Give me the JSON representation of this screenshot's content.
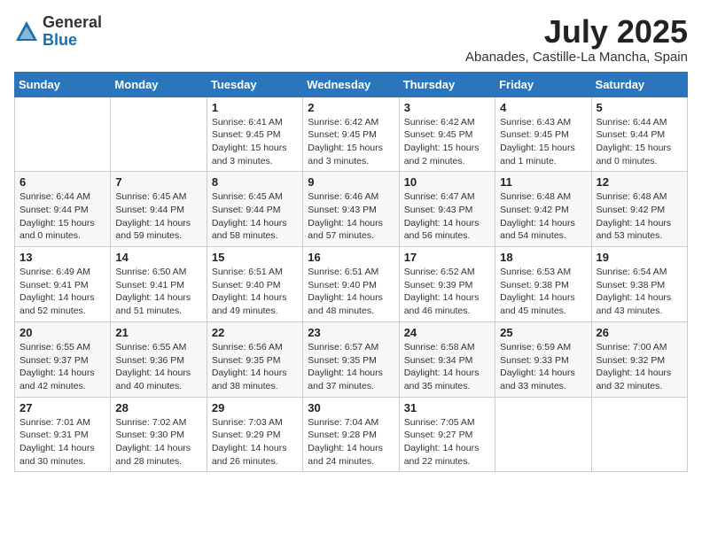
{
  "header": {
    "logo_general": "General",
    "logo_blue": "Blue",
    "month_year": "July 2025",
    "location": "Abanades, Castille-La Mancha, Spain"
  },
  "weekdays": [
    "Sunday",
    "Monday",
    "Tuesday",
    "Wednesday",
    "Thursday",
    "Friday",
    "Saturday"
  ],
  "weeks": [
    [
      {
        "day": "",
        "info": ""
      },
      {
        "day": "",
        "info": ""
      },
      {
        "day": "1",
        "info": "Sunrise: 6:41 AM\nSunset: 9:45 PM\nDaylight: 15 hours\nand 3 minutes."
      },
      {
        "day": "2",
        "info": "Sunrise: 6:42 AM\nSunset: 9:45 PM\nDaylight: 15 hours\nand 3 minutes."
      },
      {
        "day": "3",
        "info": "Sunrise: 6:42 AM\nSunset: 9:45 PM\nDaylight: 15 hours\nand 2 minutes."
      },
      {
        "day": "4",
        "info": "Sunrise: 6:43 AM\nSunset: 9:45 PM\nDaylight: 15 hours\nand 1 minute."
      },
      {
        "day": "5",
        "info": "Sunrise: 6:44 AM\nSunset: 9:44 PM\nDaylight: 15 hours\nand 0 minutes."
      }
    ],
    [
      {
        "day": "6",
        "info": "Sunrise: 6:44 AM\nSunset: 9:44 PM\nDaylight: 15 hours\nand 0 minutes."
      },
      {
        "day": "7",
        "info": "Sunrise: 6:45 AM\nSunset: 9:44 PM\nDaylight: 14 hours\nand 59 minutes."
      },
      {
        "day": "8",
        "info": "Sunrise: 6:45 AM\nSunset: 9:44 PM\nDaylight: 14 hours\nand 58 minutes."
      },
      {
        "day": "9",
        "info": "Sunrise: 6:46 AM\nSunset: 9:43 PM\nDaylight: 14 hours\nand 57 minutes."
      },
      {
        "day": "10",
        "info": "Sunrise: 6:47 AM\nSunset: 9:43 PM\nDaylight: 14 hours\nand 56 minutes."
      },
      {
        "day": "11",
        "info": "Sunrise: 6:48 AM\nSunset: 9:42 PM\nDaylight: 14 hours\nand 54 minutes."
      },
      {
        "day": "12",
        "info": "Sunrise: 6:48 AM\nSunset: 9:42 PM\nDaylight: 14 hours\nand 53 minutes."
      }
    ],
    [
      {
        "day": "13",
        "info": "Sunrise: 6:49 AM\nSunset: 9:41 PM\nDaylight: 14 hours\nand 52 minutes."
      },
      {
        "day": "14",
        "info": "Sunrise: 6:50 AM\nSunset: 9:41 PM\nDaylight: 14 hours\nand 51 minutes."
      },
      {
        "day": "15",
        "info": "Sunrise: 6:51 AM\nSunset: 9:40 PM\nDaylight: 14 hours\nand 49 minutes."
      },
      {
        "day": "16",
        "info": "Sunrise: 6:51 AM\nSunset: 9:40 PM\nDaylight: 14 hours\nand 48 minutes."
      },
      {
        "day": "17",
        "info": "Sunrise: 6:52 AM\nSunset: 9:39 PM\nDaylight: 14 hours\nand 46 minutes."
      },
      {
        "day": "18",
        "info": "Sunrise: 6:53 AM\nSunset: 9:38 PM\nDaylight: 14 hours\nand 45 minutes."
      },
      {
        "day": "19",
        "info": "Sunrise: 6:54 AM\nSunset: 9:38 PM\nDaylight: 14 hours\nand 43 minutes."
      }
    ],
    [
      {
        "day": "20",
        "info": "Sunrise: 6:55 AM\nSunset: 9:37 PM\nDaylight: 14 hours\nand 42 minutes."
      },
      {
        "day": "21",
        "info": "Sunrise: 6:55 AM\nSunset: 9:36 PM\nDaylight: 14 hours\nand 40 minutes."
      },
      {
        "day": "22",
        "info": "Sunrise: 6:56 AM\nSunset: 9:35 PM\nDaylight: 14 hours\nand 38 minutes."
      },
      {
        "day": "23",
        "info": "Sunrise: 6:57 AM\nSunset: 9:35 PM\nDaylight: 14 hours\nand 37 minutes."
      },
      {
        "day": "24",
        "info": "Sunrise: 6:58 AM\nSunset: 9:34 PM\nDaylight: 14 hours\nand 35 minutes."
      },
      {
        "day": "25",
        "info": "Sunrise: 6:59 AM\nSunset: 9:33 PM\nDaylight: 14 hours\nand 33 minutes."
      },
      {
        "day": "26",
        "info": "Sunrise: 7:00 AM\nSunset: 9:32 PM\nDaylight: 14 hours\nand 32 minutes."
      }
    ],
    [
      {
        "day": "27",
        "info": "Sunrise: 7:01 AM\nSunset: 9:31 PM\nDaylight: 14 hours\nand 30 minutes."
      },
      {
        "day": "28",
        "info": "Sunrise: 7:02 AM\nSunset: 9:30 PM\nDaylight: 14 hours\nand 28 minutes."
      },
      {
        "day": "29",
        "info": "Sunrise: 7:03 AM\nSunset: 9:29 PM\nDaylight: 14 hours\nand 26 minutes."
      },
      {
        "day": "30",
        "info": "Sunrise: 7:04 AM\nSunset: 9:28 PM\nDaylight: 14 hours\nand 24 minutes."
      },
      {
        "day": "31",
        "info": "Sunrise: 7:05 AM\nSunset: 9:27 PM\nDaylight: 14 hours\nand 22 minutes."
      },
      {
        "day": "",
        "info": ""
      },
      {
        "day": "",
        "info": ""
      }
    ]
  ]
}
